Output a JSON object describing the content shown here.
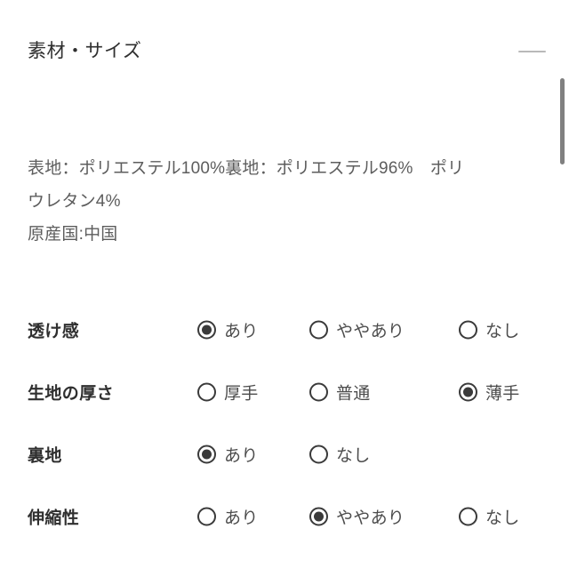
{
  "section": {
    "title": "素材・サイズ",
    "collapse_icon": "minus-icon"
  },
  "material_text": {
    "line1": "表地：ポリエステル100%裏地：ポリエステル96%　ポリ",
    "line2": "ウレタン4%",
    "line3": "原産国:中国"
  },
  "attributes": [
    {
      "label": "透け感",
      "options": [
        {
          "label": "あり",
          "selected": true
        },
        {
          "label": "ややあり",
          "selected": false
        },
        {
          "label": "なし",
          "selected": false
        }
      ]
    },
    {
      "label": "生地の厚さ",
      "options": [
        {
          "label": "厚手",
          "selected": false
        },
        {
          "label": "普通",
          "selected": false
        },
        {
          "label": "薄手",
          "selected": true
        }
      ]
    },
    {
      "label": "裏地",
      "options": [
        {
          "label": "あり",
          "selected": true
        },
        {
          "label": "なし",
          "selected": false
        }
      ]
    },
    {
      "label": "伸縮性",
      "options": [
        {
          "label": "あり",
          "selected": false
        },
        {
          "label": "ややあり",
          "selected": true
        },
        {
          "label": "なし",
          "selected": false
        }
      ]
    }
  ],
  "colors": {
    "background": "#ffffff",
    "heading_text": "#2f2f2f",
    "body_text": "#5d5d5d",
    "option_text": "#4c4c4c",
    "radio_border": "#3a3a3a",
    "collapse_bar": "#b9b9b9",
    "scrollbar_thumb": "#808080"
  }
}
